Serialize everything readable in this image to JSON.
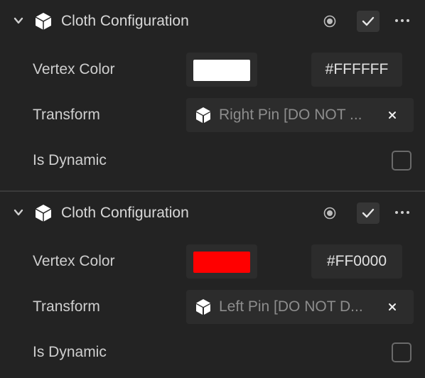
{
  "components": [
    {
      "title": "Cloth Configuration",
      "vertex_color_label": "Vertex Color",
      "vertex_color_swatch": "#FFFFFF",
      "vertex_color_hex": "#FFFFFF",
      "transform_label": "Transform",
      "transform_value": "Right Pin [DO NOT ...",
      "is_dynamic_label": "Is Dynamic",
      "is_dynamic_checked": false
    },
    {
      "title": "Cloth Configuration",
      "vertex_color_label": "Vertex Color",
      "vertex_color_swatch": "#FF0000",
      "vertex_color_hex": "#FF0000",
      "transform_label": "Transform",
      "transform_value": "Left Pin [DO NOT D...",
      "is_dynamic_label": "Is Dynamic",
      "is_dynamic_checked": false
    }
  ],
  "icons": {
    "collapse": "chevron-down-icon",
    "component": "cube-icon",
    "enabled_toggle": "radio-dot-icon",
    "confirm": "check-icon",
    "menu": "more-horizontal-icon",
    "object_ref": "scene-object-icon",
    "clear": "close-icon"
  }
}
